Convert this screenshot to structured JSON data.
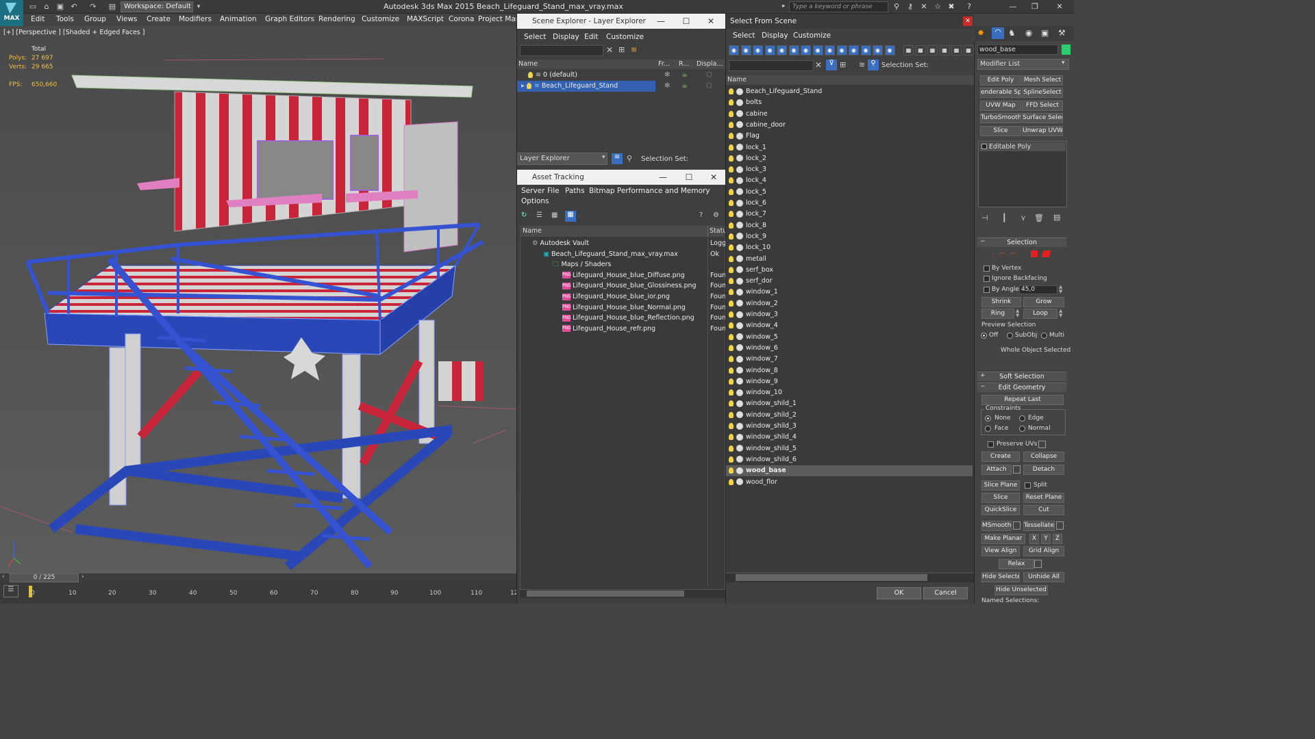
{
  "app": {
    "logo_label": "MAX",
    "title": "Autodesk 3ds Max  2015      Beach_Lifeguard_Stand_max_vray.max",
    "workspace": "Workspace: Default",
    "search_placeholder": "Type a keyword or phrase"
  },
  "menu": [
    "Edit",
    "Tools",
    "Group",
    "Views",
    "Create",
    "Modifiers",
    "Animation",
    "Graph Editors",
    "Rendering",
    "Customize",
    "MAXScript",
    "Corona",
    "Project Man"
  ],
  "viewport": {
    "label": "[+] [Perspective ] [Shaded + Edged Faces ]",
    "stats_header": "Total",
    "polys_label": "Polys:",
    "polys_value": "27 697",
    "verts_label": "Verts:",
    "verts_value": "29 665",
    "fps_label": "FPS:",
    "fps_value": "650,660",
    "colors": {
      "red": "#c8243a",
      "white": "#d6d6d6",
      "blue": "#2a47b8",
      "grid": "#5a5a5a"
    }
  },
  "timeline": {
    "slider": "0 / 225",
    "ticks": [
      "0",
      "10",
      "20",
      "30",
      "40",
      "50",
      "60",
      "70",
      "80",
      "90",
      "100",
      "110",
      "12"
    ],
    "progress": 0
  },
  "scene_explorer": {
    "title": "Scene Explorer - Layer Explorer",
    "menu": [
      "Select",
      "Display",
      "Edit",
      "Customize"
    ],
    "columns": [
      "Name",
      "Fr...",
      "R...",
      "Displa..."
    ],
    "rows": [
      {
        "name": "0 (default)",
        "selected": false
      },
      {
        "name": "Beach_Lifeguard_Stand",
        "selected": true
      }
    ],
    "footer_dropdown": "Layer Explorer",
    "selection_set": "Selection Set:"
  },
  "asset_tracking": {
    "title": "Asset Tracking",
    "menu": [
      "Server",
      "File",
      "Paths",
      "Bitmap Performance and Memory"
    ],
    "menu2": "Options",
    "columns": [
      "Name",
      "Statu"
    ],
    "rows": [
      {
        "name": "Autodesk Vault",
        "status": "Logg",
        "type": "vault"
      },
      {
        "name": "Beach_Lifeguard_Stand_max_vray.max",
        "status": "Ok",
        "type": "max"
      },
      {
        "name": "Maps / Shaders",
        "status": "",
        "type": "folder"
      },
      {
        "name": "Lifeguard_House_blue_Diffuse.png",
        "status": "Foun",
        "type": "png"
      },
      {
        "name": "Lifeguard_House_blue_Glossiness.png",
        "status": "Foun",
        "type": "png"
      },
      {
        "name": "Lifeguard_House_blue_ior.png",
        "status": "Foun",
        "type": "png"
      },
      {
        "name": "Lifeguard_House_blue_Normal.png",
        "status": "Foun",
        "type": "png"
      },
      {
        "name": "Lifeguard_House_blue_Reflection.png",
        "status": "Foun",
        "type": "png"
      },
      {
        "name": "Lifeguard_House_refr.png",
        "status": "Foun",
        "type": "png"
      }
    ]
  },
  "select_from_scene": {
    "title": "Select From Scene",
    "menu": [
      "Select",
      "Display",
      "Customize"
    ],
    "selection_set": "Selection Set:",
    "column": "Name",
    "items": [
      "Beach_Lifeguard_Stand",
      "bolts",
      "cabine",
      "cabine_door",
      "Flag",
      "lock_1",
      "lock_2",
      "lock_3",
      "lock_4",
      "lock_5",
      "lock_6",
      "lock_7",
      "lock_8",
      "lock_9",
      "lock_10",
      "metall",
      "serf_box",
      "serf_dor",
      "window_1",
      "window_2",
      "window_3",
      "window_4",
      "window_5",
      "window_6",
      "window_7",
      "window_8",
      "window_9",
      "window_10",
      "window_shild_1",
      "window_shild_2",
      "window_shild_3",
      "window_shild_4",
      "window_shild_5",
      "window_shild_6",
      "wood_base",
      "wood_flor"
    ],
    "selected_item": "wood_base",
    "ok": "OK",
    "cancel": "Cancel"
  },
  "command_panel": {
    "object_name": "wood_base",
    "modifier_list": "Modifier List",
    "modifier_buttons": [
      "Edit Poly",
      "Mesh Select",
      "enderable Splir",
      "SplineSelect",
      "UVW Map",
      "FFD Select",
      "TurboSmooth",
      "Surface Select",
      "Slice",
      "Unwrap UVW"
    ],
    "stack_item": "Editable Poly",
    "selection": {
      "title": "Selection",
      "by_vertex": "By Vertex",
      "ignore_backfacing": "Ignore Backfacing",
      "by_angle": "By Angle:",
      "angle_value": "45,0",
      "shrink": "Shrink",
      "grow": "Grow",
      "ring": "Ring",
      "loop": "Loop",
      "preview_selection": "Preview Selection",
      "preview_options": [
        "Off",
        "SubObj",
        "Multi"
      ],
      "whole_object": "Whole Object Selected"
    },
    "soft_selection": "Soft Selection",
    "edit_geometry": {
      "title": "Edit Geometry",
      "repeat_last": "Repeat Last",
      "constraints": "Constraints",
      "none": "None",
      "edge": "Edge",
      "face": "Face",
      "normal": "Normal",
      "preserve_uvs": "Preserve UVs",
      "create": "Create",
      "collapse": "Collapse",
      "attach": "Attach",
      "detach": "Detach",
      "slice_plane": "Slice Plane",
      "split": "Split",
      "slice": "Slice",
      "reset_plane": "Reset Plane",
      "quickslice": "QuickSlice",
      "cut": "Cut",
      "msmooth": "MSmooth",
      "tessellate": "Tessellate",
      "make_planar": "Make Planar",
      "x": "X",
      "y": "Y",
      "z": "Z",
      "view_align": "View Align",
      "grid_align": "Grid Align",
      "relax": "Relax",
      "hide_selected": "Hide Selected",
      "unhide_all": "Unhide All",
      "hide_unselected": "Hide Unselected",
      "named_selections": "Named Selections:"
    }
  }
}
